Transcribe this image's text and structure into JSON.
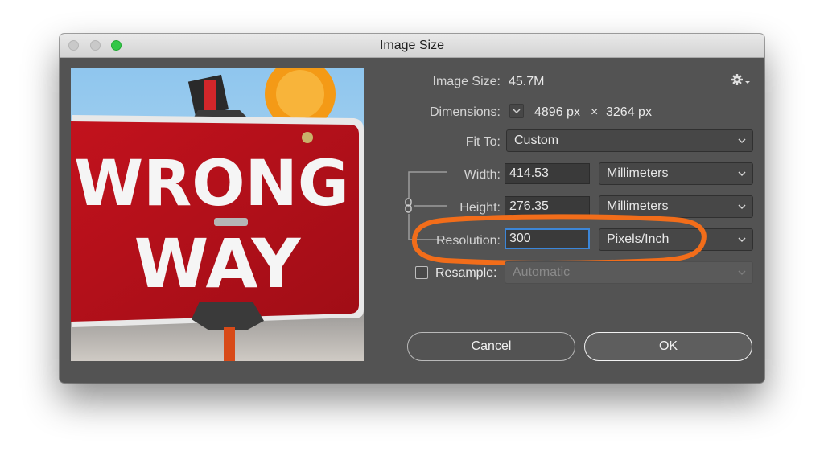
{
  "window": {
    "title": "Image Size"
  },
  "preview": {
    "sign_text_line1": "WRONG",
    "sign_text_line2": "WAY"
  },
  "image_size": {
    "label": "Image Size:",
    "value": "45.7M"
  },
  "dimensions": {
    "label": "Dimensions:",
    "width": "4896 px",
    "separator": "×",
    "height": "3264 px"
  },
  "fit_to": {
    "label": "Fit To:",
    "value": "Custom"
  },
  "width": {
    "label": "Width:",
    "value": "414.53",
    "unit": "Millimeters"
  },
  "height": {
    "label": "Height:",
    "value": "276.35",
    "unit": "Millimeters"
  },
  "resolution": {
    "label": "Resolution:",
    "value": "300",
    "unit": "Pixels/Inch"
  },
  "resample": {
    "label": "Resample:",
    "checked": false,
    "method": "Automatic"
  },
  "buttons": {
    "cancel": "Cancel",
    "ok": "OK"
  },
  "colors": {
    "panel": "#535353",
    "highlight_annotation": "#f26d1a",
    "focus_ring": "#3c86d8",
    "sign_red": "#b8111b"
  },
  "icons": [
    "gear-icon",
    "chevron-down-icon",
    "link-chain-icon"
  ]
}
